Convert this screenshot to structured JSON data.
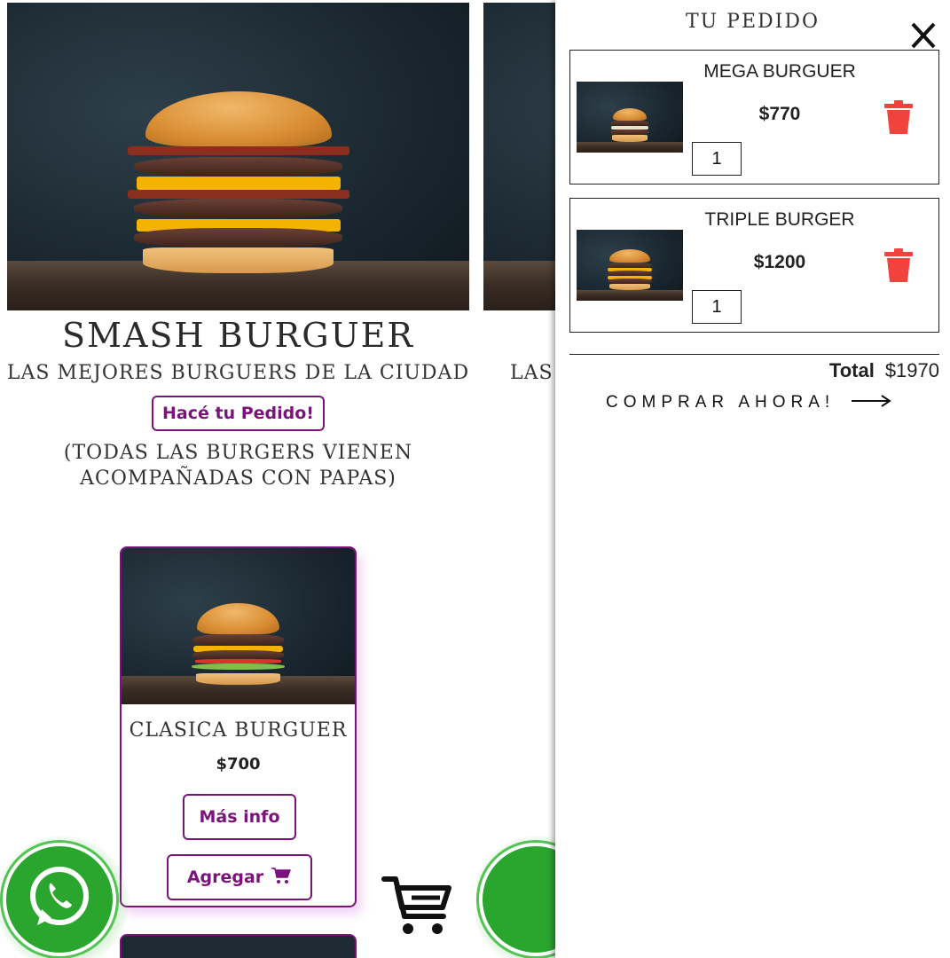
{
  "hero": {
    "title": "SMASH BURGUER",
    "subtitle": "LAS MEJORES BURGUERS DE LA CIUDAD",
    "cta_label": "Hacé tu Pedido!",
    "note_line1": "(TODAS LAS BURGERS VIENEN",
    "note_line2": "ACOMPAÑADAS CON PAPAS)",
    "subtitle_partial": "LAS M"
  },
  "product_card": {
    "name": "CLASICA BURGUER",
    "price": "$700",
    "more_info_label": "Más info",
    "add_label": "Agregar"
  },
  "cart": {
    "title": "TU PEDIDO",
    "items": [
      {
        "name": "MEGA BURGUER",
        "price": "$770",
        "quantity": "1"
      },
      {
        "name": "TRIPLE BURGER",
        "price": "$1200",
        "quantity": "1"
      }
    ],
    "total_label": "Total",
    "total_value": "$1970",
    "checkout_label": "COMPRAR AHORA!"
  },
  "icons": {
    "close": "close-icon",
    "trash": "trash-icon",
    "cart": "cart-icon",
    "whatsapp": "whatsapp-icon",
    "arrow": "arrow-right-icon"
  },
  "colors": {
    "accent": "#7a137a",
    "trash": "#f2423c",
    "whatsapp": "#2aa62f"
  }
}
